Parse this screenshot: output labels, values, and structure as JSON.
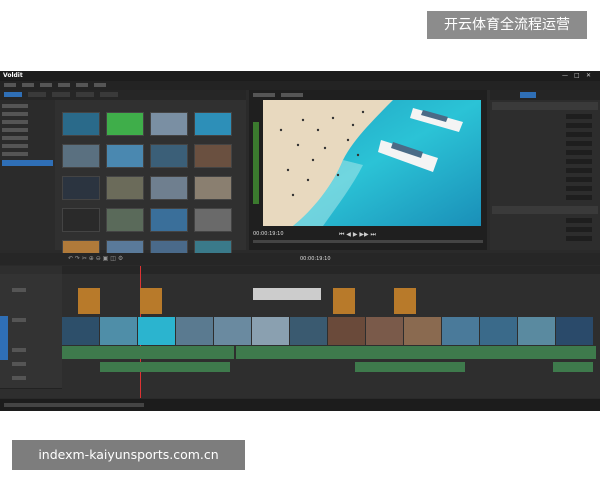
{
  "watermark": {
    "top": "开云体育全流程运营",
    "bottom": "indexm-kaiyunsports.com.cn"
  },
  "app": {
    "logo": "Voldit",
    "window_controls": [
      "—",
      "□",
      "✕"
    ]
  },
  "preview": {
    "timecode_left": "00:00:19:10",
    "timecode_center": "00:00:19:10"
  },
  "colors": {
    "accent": "#2f6fb6",
    "clip_blue": "#4a7fa8",
    "clip_orange": "#c07a2a",
    "audio_green": "#3e7a4c"
  }
}
